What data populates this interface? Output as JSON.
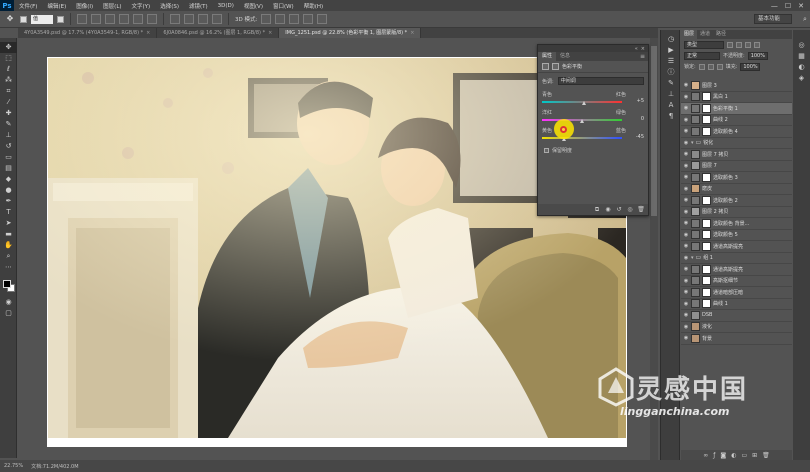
{
  "app": {
    "logo": "Ps"
  },
  "menu": {
    "items": [
      "文件(F)",
      "编辑(E)",
      "图像(I)",
      "图层(L)",
      "文字(Y)",
      "选择(S)",
      "滤镜(T)",
      "3D(D)",
      "视图(V)",
      "窗口(W)",
      "帮助(H)"
    ],
    "win_controls": [
      "—",
      "☐",
      "✕"
    ]
  },
  "options_bar": {
    "size_value": "值",
    "show_transform_label": "3D 模式:",
    "workspace": "基本功能"
  },
  "doc_tabs": [
    {
      "label": "4Y0A3549.psd @ 17.7% (4Y0A3549-1, RGB/8) *",
      "active": false
    },
    {
      "label": "6J0A0846.psd @ 16.2% (图层 1, RGB/8) *",
      "active": false
    },
    {
      "label": "IMG_1251.psd @ 22.8% (色彩平衡 1, 图层蒙版/8) *",
      "active": true
    }
  ],
  "properties_panel": {
    "tabs": [
      "属性",
      "信息"
    ],
    "title": "色彩平衡",
    "tone_label": "色调:",
    "tone_value": "中间调",
    "sliders": [
      {
        "left": "青色",
        "right": "红色",
        "value": "+5",
        "position": 0.525,
        "gradient": "linear-gradient(to right,#00c8c8,#ff3030)"
      },
      {
        "left": "洋红",
        "right": "绿色",
        "value": "0",
        "position": 0.5,
        "gradient": "linear-gradient(to right,#ff30ff,#30d030)"
      },
      {
        "left": "黄色",
        "right": "蓝色",
        "value": "-45",
        "position": 0.275,
        "gradient": "linear-gradient(to right,#f0e000,#3050ff)"
      }
    ],
    "preserve_luminosity": "保留明度"
  },
  "layers_panel": {
    "tabs": [
      "图层",
      "通道",
      "路径"
    ],
    "filter_kind": "类型",
    "blend_mode": "正常",
    "opacity_label": "不透明度:",
    "opacity_value": "100%",
    "lock_label": "锁定:",
    "fill_label": "填充:",
    "fill_value": "100%",
    "layers": [
      {
        "name": "图层 3",
        "type": "pixel",
        "thumb": "#d6b08a"
      },
      {
        "name": "黑白 1",
        "type": "adj"
      },
      {
        "name": "色彩平衡 1",
        "type": "adj",
        "selected": true
      },
      {
        "name": "曲线 2",
        "type": "adj"
      },
      {
        "name": "选取颜色 4",
        "type": "adj"
      },
      {
        "name": "锐化",
        "type": "group"
      },
      {
        "name": "图层 7 拷贝",
        "type": "pixel",
        "thumb": "#8a8a8a"
      },
      {
        "name": "图层 7",
        "type": "pixel",
        "thumb": "#9a9a9a"
      },
      {
        "name": "选取颜色 3",
        "type": "adj"
      },
      {
        "name": "磨皮",
        "type": "pixel",
        "thumb": "#c9a27a"
      },
      {
        "name": "选取颜色 2",
        "type": "adj"
      },
      {
        "name": "图层 2 拷贝",
        "type": "pixel",
        "thumb": "#a0a0a0"
      },
      {
        "name": "选取颜色 背景...",
        "type": "adj"
      },
      {
        "name": "选取颜色 5",
        "type": "adj"
      },
      {
        "name": "通道高斯提亮",
        "type": "adj"
      },
      {
        "name": "组 1",
        "type": "group"
      },
      {
        "name": "通道高斯提亮",
        "type": "adj"
      },
      {
        "name": "高斯抠细节",
        "type": "adj"
      },
      {
        "name": "通道暗部压暗",
        "type": "adj"
      },
      {
        "name": "曲线 1",
        "type": "adj"
      },
      {
        "name": "DSB",
        "type": "pixel",
        "thumb": "#8f8f8f"
      },
      {
        "name": "液化",
        "type": "pixel",
        "thumb": "#b89575"
      },
      {
        "name": "背景",
        "type": "pixel",
        "thumb": "#b89575"
      }
    ]
  },
  "status_bar": {
    "zoom": "22.75%",
    "doc_size": "文档:71.2M/402.0M"
  },
  "watermark": {
    "title": "灵感中国",
    "url": "lingganchina.com"
  },
  "colors": {
    "accent": "#31a8ff",
    "panel": "#535353",
    "chrome": "#434343"
  }
}
